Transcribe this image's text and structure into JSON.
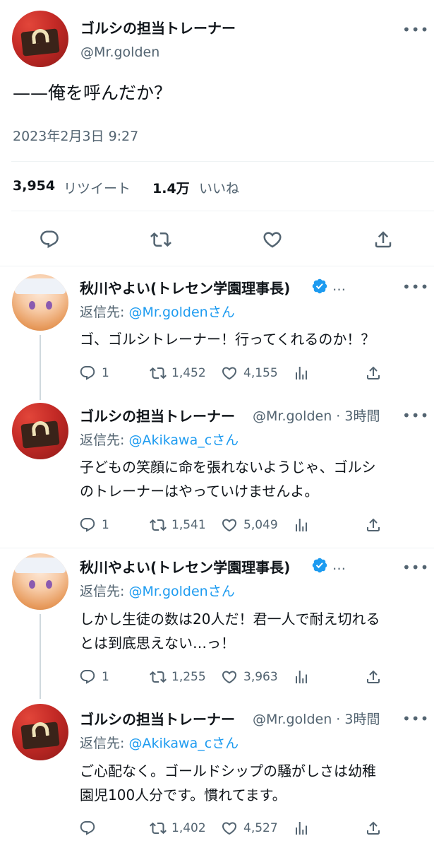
{
  "main_tweet": {
    "author_name": "ゴルシの担当トレーナー",
    "author_handle": "@Mr.golden",
    "text": "——俺を呼んだか？",
    "timestamp": "2023年2月3日 9:27",
    "retweets_count": "3,954",
    "retweets_label": "リツイート",
    "likes_count": "1.4万",
    "likes_label": "いいね"
  },
  "replies": [
    {
      "author_name": "秋川やよい(トレセン学園理事長)",
      "verified": true,
      "meta": "…",
      "reply_prefix": "返信先: ",
      "reply_to": "@Mr.goldenさん",
      "text": "ゴ、ゴルシトレーナー！行ってくれるのか！？",
      "replies": "1",
      "retweets": "1,452",
      "likes": "4,155"
    },
    {
      "author_name": "ゴルシの担当トレーナー",
      "verified": false,
      "meta": "@Mr.golden · 3時間",
      "reply_prefix": "返信先: ",
      "reply_to": "@Akikawa_cさん",
      "text_line1": "子どもの笑顔に命を張れないようじゃ、ゴルシ",
      "text_line2": "のトレーナーはやっていけませんよ。",
      "replies": "1",
      "retweets": "1,541",
      "likes": "5,049"
    },
    {
      "author_name": "秋川やよい(トレセン学園理事長)",
      "verified": true,
      "meta": "…",
      "reply_prefix": "返信先: ",
      "reply_to": "@Mr.goldenさん",
      "text_line1": "しかし生徒の数は20人だ！君一人で耐え切れる",
      "text_line2": "とは到底思えない…っ！",
      "replies": "1",
      "retweets": "1,255",
      "likes": "3,963"
    },
    {
      "author_name": "ゴルシの担当トレーナー",
      "verified": false,
      "meta": "@Mr.golden · 3時間",
      "reply_prefix": "返信先: ",
      "reply_to": "@Akikawa_cさん",
      "text_line1": "ご心配なく。ゴールドシップの騒がしさは幼稚",
      "text_line2": "園児100人分です。慣れてます。",
      "retweets": "1,402",
      "likes": "4,527"
    }
  ],
  "icons": {
    "more": "more-icon",
    "reply": "reply-icon",
    "retweet": "retweet-icon",
    "like": "like-icon",
    "share": "share-icon",
    "analytics": "analytics-icon",
    "verified": "verified-badge-icon"
  },
  "colors": {
    "accent": "#1d9bf0",
    "text": "#0f1419",
    "muted": "#536471",
    "divider": "#eff3f4"
  }
}
